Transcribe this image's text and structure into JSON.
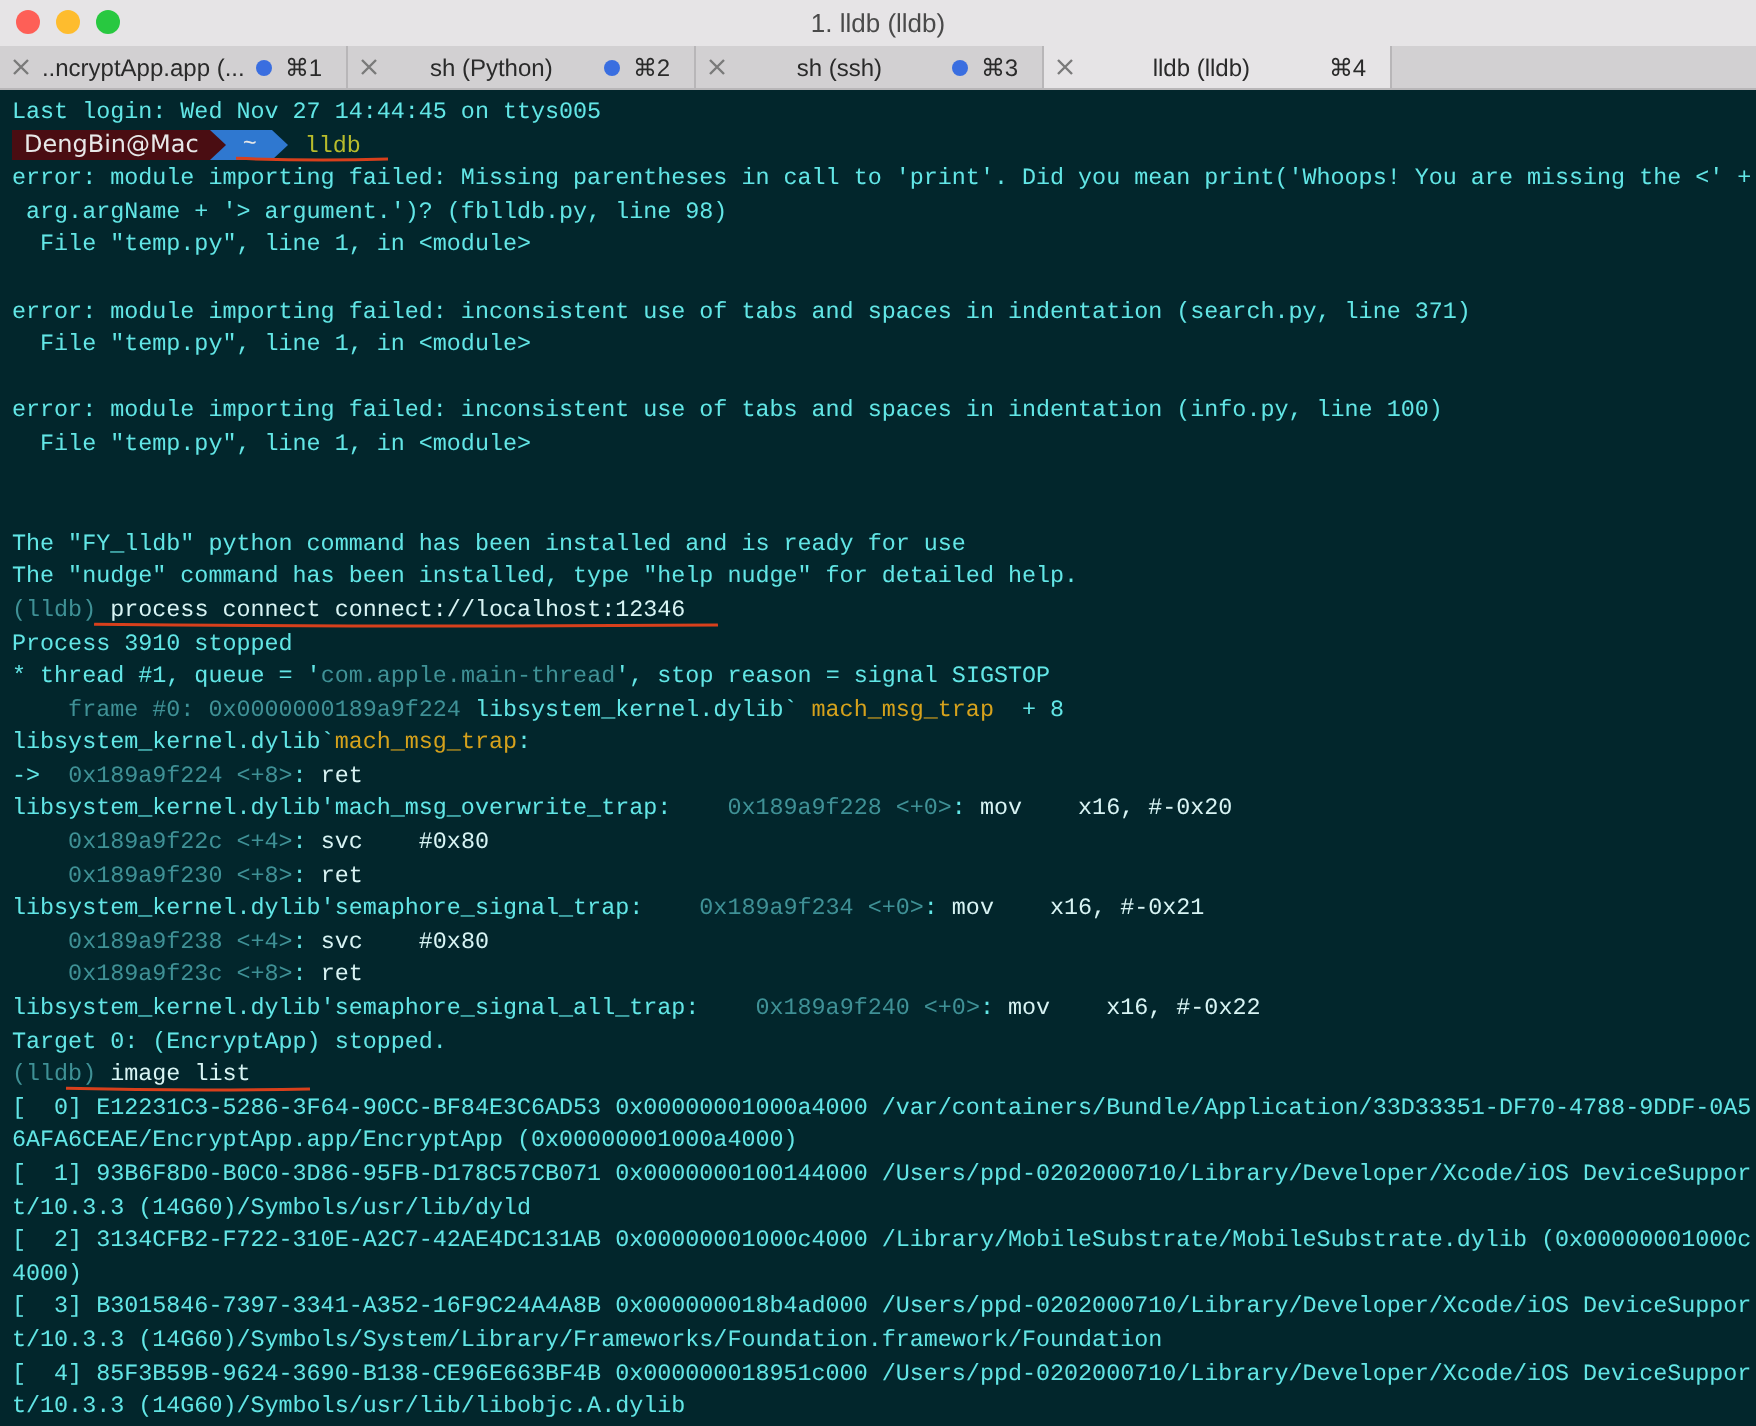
{
  "window": {
    "title": "1. lldb (lldb)"
  },
  "tabs": [
    {
      "label": "..ncryptApp.app (...",
      "shortcut": "⌘1",
      "activity": true,
      "selected": false
    },
    {
      "label": "sh (Python)",
      "shortcut": "⌘2",
      "activity": true,
      "selected": false
    },
    {
      "label": "sh (ssh)",
      "shortcut": "⌘3",
      "activity": true,
      "selected": false
    },
    {
      "label": "lldb (lldb)",
      "shortcut": "⌘4",
      "activity": false,
      "selected": true
    }
  ],
  "terminal": {
    "lines": [
      {
        "kind": "text",
        "segments": [
          {
            "kind": "plain",
            "text": "Last login: Wed Nov 27 14:44:45 on ttys005"
          }
        ]
      },
      {
        "kind": "prompt",
        "user": "DengBin@Mac",
        "dir": "~",
        "command": "lldb",
        "underlined": true
      },
      {
        "kind": "text",
        "segments": [
          {
            "kind": "plain",
            "text": "error: module importing failed: Missing parentheses in call to 'print'. Did you mean print('Whoops! You are missing the <' +"
          }
        ]
      },
      {
        "kind": "text",
        "segments": [
          {
            "kind": "plain",
            "text": " arg.argName + '> argument.')? (fblldb.py, line 98)"
          }
        ]
      },
      {
        "kind": "text",
        "segments": [
          {
            "kind": "plain",
            "text": "  File \"temp.py\", line 1, in <module>"
          }
        ]
      },
      {
        "kind": "blank"
      },
      {
        "kind": "text",
        "segments": [
          {
            "kind": "plain",
            "text": "error: module importing failed: inconsistent use of tabs and spaces in indentation (search.py, line 371)"
          }
        ]
      },
      {
        "kind": "text",
        "segments": [
          {
            "kind": "plain",
            "text": "  File \"temp.py\", line 1, in <module>"
          }
        ]
      },
      {
        "kind": "blank"
      },
      {
        "kind": "text",
        "segments": [
          {
            "kind": "plain",
            "text": "error: module importing failed: inconsistent use of tabs and spaces in indentation (info.py, line 100)"
          }
        ]
      },
      {
        "kind": "text",
        "segments": [
          {
            "kind": "plain",
            "text": "  File \"temp.py\", line 1, in <module>"
          }
        ]
      },
      {
        "kind": "blank"
      },
      {
        "kind": "blank"
      },
      {
        "kind": "text",
        "segments": [
          {
            "kind": "plain",
            "text": "The \"FY_lldb\" python command has been installed and is ready for use"
          }
        ]
      },
      {
        "kind": "text",
        "segments": [
          {
            "kind": "plain",
            "text": "The \"nudge\" command has been installed, type \"help nudge\" for detailed help."
          }
        ]
      },
      {
        "kind": "text",
        "underlined": true,
        "segments": [
          {
            "kind": "dim",
            "text": "(lldb) "
          },
          {
            "kind": "bright",
            "text": "process connect connect://localhost:12346"
          }
        ]
      },
      {
        "kind": "text",
        "segments": [
          {
            "kind": "plain",
            "text": "Process 3910 stopped"
          }
        ]
      },
      {
        "kind": "text",
        "segments": [
          {
            "kind": "plain",
            "text": "* thread #1, queue = '"
          },
          {
            "kind": "dim",
            "text": "com.apple.main-thread"
          },
          {
            "kind": "plain",
            "text": "', stop reason = signal SIGSTOP"
          }
        ]
      },
      {
        "kind": "text",
        "segments": [
          {
            "kind": "dim",
            "text": "    frame #0: 0x0000000189a9f224 "
          },
          {
            "kind": "plain",
            "text": "libsystem_kernel.dylib` "
          },
          {
            "kind": "accent",
            "text": "mach_msg_trap"
          },
          {
            "kind": "plain",
            "text": "  + 8"
          }
        ]
      },
      {
        "kind": "text",
        "segments": [
          {
            "kind": "plain",
            "text": "libsystem_kernel.dylib`"
          },
          {
            "kind": "accent",
            "text": "mach_msg_trap"
          },
          {
            "kind": "plain",
            "text": ":"
          }
        ]
      },
      {
        "kind": "text",
        "segments": [
          {
            "kind": "plain",
            "text": "->  "
          },
          {
            "kind": "dim",
            "text": "0x189a9f224 <+8>"
          },
          {
            "kind": "plain",
            "text": ": "
          },
          {
            "kind": "bright",
            "text": "ret"
          }
        ]
      },
      {
        "kind": "text",
        "segments": [
          {
            "kind": "plain",
            "text": "libsystem_kernel.dylib'mach_msg_overwrite_trap:    "
          },
          {
            "kind": "dim",
            "text": "0x189a9f228 <+0>"
          },
          {
            "kind": "plain",
            "text": ": "
          },
          {
            "kind": "bright",
            "text": "mov    x16, #-0x20"
          }
        ]
      },
      {
        "kind": "text",
        "segments": [
          {
            "kind": "dim",
            "text": "    0x189a9f22c <+4>"
          },
          {
            "kind": "plain",
            "text": ": "
          },
          {
            "kind": "bright",
            "text": "svc    #0x80"
          }
        ]
      },
      {
        "kind": "text",
        "segments": [
          {
            "kind": "dim",
            "text": "    0x189a9f230 <+8>"
          },
          {
            "kind": "plain",
            "text": ": "
          },
          {
            "kind": "bright",
            "text": "ret"
          }
        ]
      },
      {
        "kind": "text",
        "segments": [
          {
            "kind": "plain",
            "text": "libsystem_kernel.dylib'semaphore_signal_trap:    "
          },
          {
            "kind": "dim",
            "text": "0x189a9f234 <+0>"
          },
          {
            "kind": "plain",
            "text": ": "
          },
          {
            "kind": "bright",
            "text": "mov    x16, #-0x21"
          }
        ]
      },
      {
        "kind": "text",
        "segments": [
          {
            "kind": "dim",
            "text": "    0x189a9f238 <+4>"
          },
          {
            "kind": "plain",
            "text": ": "
          },
          {
            "kind": "bright",
            "text": "svc    #0x80"
          }
        ]
      },
      {
        "kind": "text",
        "segments": [
          {
            "kind": "dim",
            "text": "    0x189a9f23c <+8>"
          },
          {
            "kind": "plain",
            "text": ": "
          },
          {
            "kind": "bright",
            "text": "ret"
          }
        ]
      },
      {
        "kind": "text",
        "segments": [
          {
            "kind": "plain",
            "text": "libsystem_kernel.dylib'semaphore_signal_all_trap:    "
          },
          {
            "kind": "dim",
            "text": "0x189a9f240 <+0>"
          },
          {
            "kind": "plain",
            "text": ": "
          },
          {
            "kind": "bright",
            "text": "mov    x16, #-0x22"
          }
        ]
      },
      {
        "kind": "text",
        "segments": [
          {
            "kind": "plain",
            "text": "Target 0: (EncryptApp) stopped."
          }
        ]
      },
      {
        "kind": "text",
        "underlined": true,
        "segments": [
          {
            "kind": "dim",
            "text": "(lldb) "
          },
          {
            "kind": "bright",
            "text": "image list"
          }
        ]
      },
      {
        "kind": "text",
        "segments": [
          {
            "kind": "plain",
            "text": "[  0] E12231C3-5286-3F64-90CC-BF84E3C6AD53 0x00000001000a4000 /var/containers/Bundle/Application/33D33351-DF70-4788-9DDF-0A5"
          }
        ]
      },
      {
        "kind": "text",
        "segments": [
          {
            "kind": "plain",
            "text": "6AFA6CEAE/EncryptApp.app/EncryptApp (0x00000001000a4000)"
          }
        ]
      },
      {
        "kind": "text",
        "segments": [
          {
            "kind": "plain",
            "text": "[  1] 93B6F8D0-B0C0-3D86-95FB-D178C57CB071 0x0000000100144000 /Users/ppd-0202000710/Library/Developer/Xcode/iOS DeviceSuppor"
          }
        ]
      },
      {
        "kind": "text",
        "segments": [
          {
            "kind": "plain",
            "text": "t/10.3.3 (14G60)/Symbols/usr/lib/dyld"
          }
        ]
      },
      {
        "kind": "text",
        "segments": [
          {
            "kind": "plain",
            "text": "[  2] 3134CFB2-F722-310E-A2C7-42AE4DC131AB 0x00000001000c4000 /Library/MobileSubstrate/MobileSubstrate.dylib (0x00000001000c"
          }
        ]
      },
      {
        "kind": "text",
        "segments": [
          {
            "kind": "plain",
            "text": "4000)"
          }
        ]
      },
      {
        "kind": "text",
        "segments": [
          {
            "kind": "plain",
            "text": "[  3] B3015846-7397-3341-A352-16F9C24A4A8B 0x000000018b4ad000 /Users/ppd-0202000710/Library/Developer/Xcode/iOS DeviceSuppor"
          }
        ]
      },
      {
        "kind": "text",
        "segments": [
          {
            "kind": "plain",
            "text": "t/10.3.3 (14G60)/Symbols/System/Library/Frameworks/Foundation.framework/Foundation"
          }
        ]
      },
      {
        "kind": "text",
        "segments": [
          {
            "kind": "plain",
            "text": "[  4] 85F3B59B-9624-3690-B138-CE96E663BF4B 0x000000018951c000 /Users/ppd-0202000710/Library/Developer/Xcode/iOS DeviceSuppor"
          }
        ]
      },
      {
        "kind": "text",
        "segments": [
          {
            "kind": "plain",
            "text": "t/10.3.3 (14G60)/Symbols/usr/lib/libobjc.A.dylib"
          }
        ]
      }
    ]
  }
}
